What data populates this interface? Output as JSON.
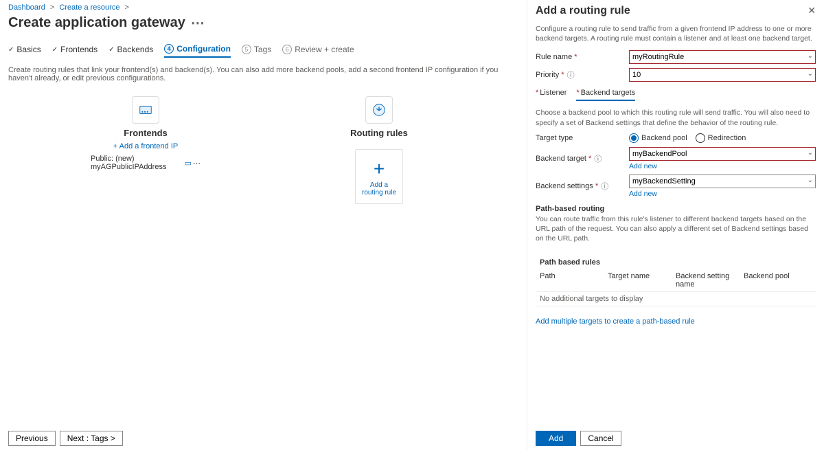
{
  "breadcrumb": {
    "item1": "Dashboard",
    "item2": "Create a resource"
  },
  "title": "Create application gateway",
  "steps": {
    "basics": "Basics",
    "frontends": "Frontends",
    "backends": "Backends",
    "configuration": "Configuration",
    "tags_num": "5",
    "tags": "Tags",
    "review_num": "6",
    "review": "Review + create"
  },
  "helper": "Create routing rules that link your frontend(s) and backend(s). You can also add more backend pools, add a second frontend IP configuration if you haven't already, or edit previous configurations.",
  "frontends": {
    "title": "Frontends",
    "add": "+ Add a frontend IP",
    "ip_label": "Public: (new) myAGPublicIPAddress"
  },
  "rules": {
    "title": "Routing rules",
    "card_label": "Add a routing rule"
  },
  "footer": {
    "prev": "Previous",
    "next": "Next : Tags >"
  },
  "panel": {
    "title": "Add a routing rule",
    "desc": "Configure a routing rule to send traffic from a given frontend IP address to one or more backend targets. A routing rule must contain a listener and at least one backend target.",
    "rule_name_lbl": "Rule name",
    "rule_name_val": "myRoutingRule",
    "priority_lbl": "Priority",
    "priority_val": "10",
    "tab_listener": "Listener",
    "tab_backend": "Backend targets",
    "backend_desc": "Choose a backend pool to which this routing rule will send traffic. You will also need to specify a set of Backend settings that define the behavior of the routing rule.",
    "target_type_lbl": "Target type",
    "radio_pool": "Backend pool",
    "radio_redir": "Redirection",
    "backend_target_lbl": "Backend target",
    "backend_target_val": "myBackendPool",
    "backend_settings_lbl": "Backend settings",
    "backend_settings_val": "myBackendSetting",
    "addnew": "Add new",
    "path_head": "Path-based routing",
    "path_desc": "You can route traffic from this rule's listener to different backend targets based on the URL path of the request. You can also apply a different set of Backend settings based on the URL path.",
    "tbl_caption": "Path based rules",
    "col_path": "Path",
    "col_target": "Target name",
    "col_setting": "Backend setting name",
    "col_pool": "Backend pool",
    "empty": "No additional targets to display",
    "multilink": "Add multiple targets to create a path-based rule",
    "add": "Add",
    "cancel": "Cancel"
  }
}
